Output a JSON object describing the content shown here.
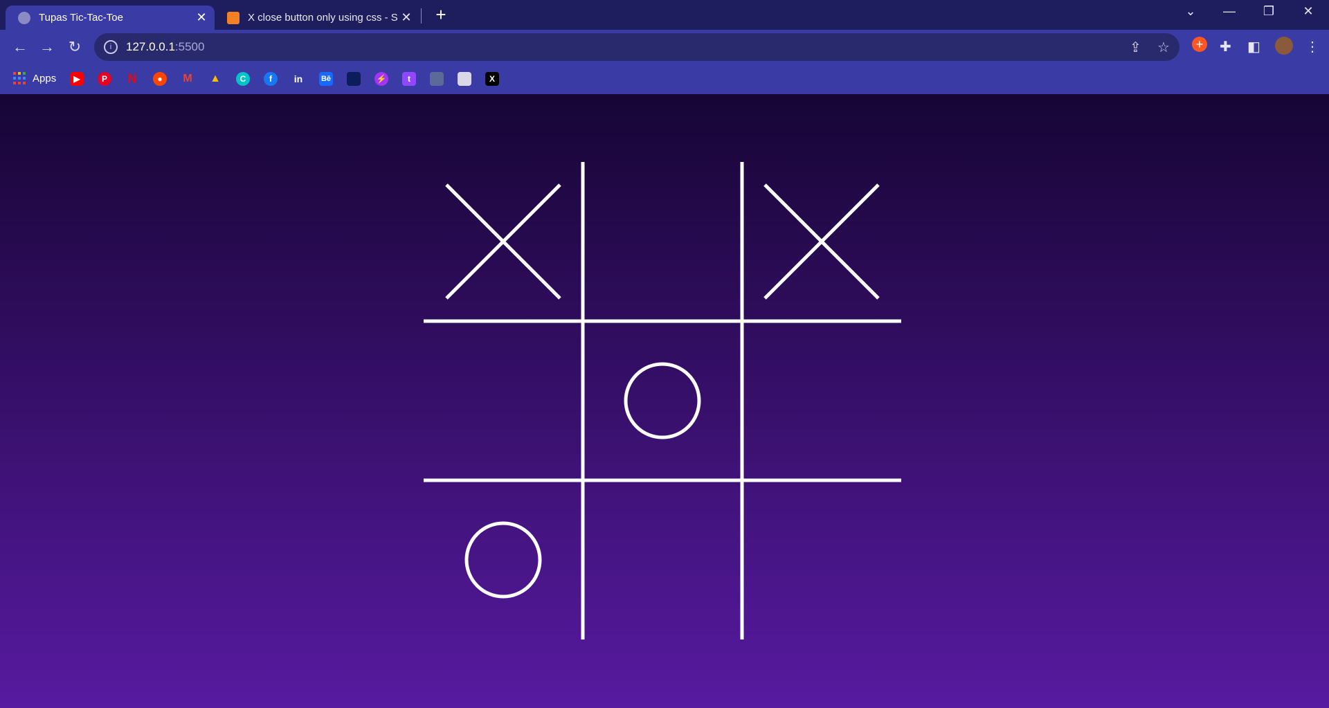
{
  "browser": {
    "tabs": [
      {
        "title": "Tupas Tic-Tac-Toe",
        "active": true
      },
      {
        "title": "X close button only using css - St",
        "active": false
      }
    ],
    "new_tab": "+",
    "url_host": "127.0.0.1",
    "url_port": ":5500",
    "bookmarks_apps_label": "Apps",
    "bookmark_icons": [
      "youtube-icon",
      "pinterest-icon",
      "netflix-icon",
      "reddit-icon",
      "gmail-icon",
      "google-drive-icon",
      "canva-icon",
      "facebook-icon",
      "linkedin-icon",
      "behance-icon",
      "disney-plus-icon",
      "messenger-icon",
      "twitch-icon",
      "bookmark-app-icon",
      "roblox-icon",
      "x-icon"
    ],
    "bookmark_letters": {
      "pinterest": "P",
      "netflix": "N",
      "gmail": "M",
      "canva": "C",
      "facebook": "f",
      "linkedin": "in",
      "behance": "Bē",
      "twitch": "t",
      "x": "X"
    }
  },
  "game": {
    "title": "Tupas Tic-Tac-Toe",
    "board": [
      [
        "X",
        "",
        "X"
      ],
      [
        "",
        "O",
        ""
      ],
      [
        "O",
        "",
        ""
      ]
    ],
    "colors": {
      "background_top": "#170535",
      "background_bottom": "#571aa0",
      "marks": "#ffffff"
    }
  }
}
